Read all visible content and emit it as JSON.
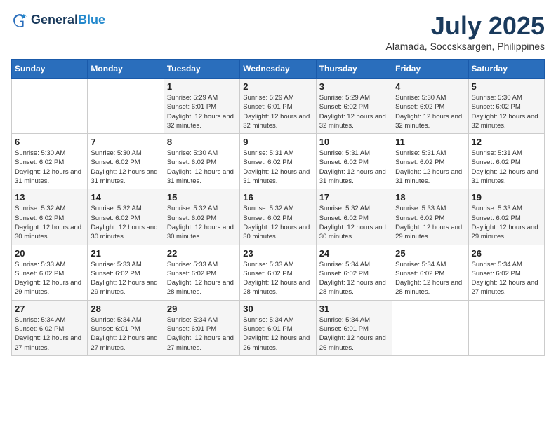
{
  "header": {
    "logo_general": "General",
    "logo_blue": "Blue",
    "month_year": "July 2025",
    "location": "Alamada, Soccsksargen, Philippines"
  },
  "weekdays": [
    "Sunday",
    "Monday",
    "Tuesday",
    "Wednesday",
    "Thursday",
    "Friday",
    "Saturday"
  ],
  "weeks": [
    [
      {
        "day": "",
        "info": ""
      },
      {
        "day": "",
        "info": ""
      },
      {
        "day": "1",
        "info": "Sunrise: 5:29 AM\nSunset: 6:01 PM\nDaylight: 12 hours and 32 minutes."
      },
      {
        "day": "2",
        "info": "Sunrise: 5:29 AM\nSunset: 6:01 PM\nDaylight: 12 hours and 32 minutes."
      },
      {
        "day": "3",
        "info": "Sunrise: 5:29 AM\nSunset: 6:02 PM\nDaylight: 12 hours and 32 minutes."
      },
      {
        "day": "4",
        "info": "Sunrise: 5:30 AM\nSunset: 6:02 PM\nDaylight: 12 hours and 32 minutes."
      },
      {
        "day": "5",
        "info": "Sunrise: 5:30 AM\nSunset: 6:02 PM\nDaylight: 12 hours and 32 minutes."
      }
    ],
    [
      {
        "day": "6",
        "info": "Sunrise: 5:30 AM\nSunset: 6:02 PM\nDaylight: 12 hours and 31 minutes."
      },
      {
        "day": "7",
        "info": "Sunrise: 5:30 AM\nSunset: 6:02 PM\nDaylight: 12 hours and 31 minutes."
      },
      {
        "day": "8",
        "info": "Sunrise: 5:30 AM\nSunset: 6:02 PM\nDaylight: 12 hours and 31 minutes."
      },
      {
        "day": "9",
        "info": "Sunrise: 5:31 AM\nSunset: 6:02 PM\nDaylight: 12 hours and 31 minutes."
      },
      {
        "day": "10",
        "info": "Sunrise: 5:31 AM\nSunset: 6:02 PM\nDaylight: 12 hours and 31 minutes."
      },
      {
        "day": "11",
        "info": "Sunrise: 5:31 AM\nSunset: 6:02 PM\nDaylight: 12 hours and 31 minutes."
      },
      {
        "day": "12",
        "info": "Sunrise: 5:31 AM\nSunset: 6:02 PM\nDaylight: 12 hours and 31 minutes."
      }
    ],
    [
      {
        "day": "13",
        "info": "Sunrise: 5:32 AM\nSunset: 6:02 PM\nDaylight: 12 hours and 30 minutes."
      },
      {
        "day": "14",
        "info": "Sunrise: 5:32 AM\nSunset: 6:02 PM\nDaylight: 12 hours and 30 minutes."
      },
      {
        "day": "15",
        "info": "Sunrise: 5:32 AM\nSunset: 6:02 PM\nDaylight: 12 hours and 30 minutes."
      },
      {
        "day": "16",
        "info": "Sunrise: 5:32 AM\nSunset: 6:02 PM\nDaylight: 12 hours and 30 minutes."
      },
      {
        "day": "17",
        "info": "Sunrise: 5:32 AM\nSunset: 6:02 PM\nDaylight: 12 hours and 30 minutes."
      },
      {
        "day": "18",
        "info": "Sunrise: 5:33 AM\nSunset: 6:02 PM\nDaylight: 12 hours and 29 minutes."
      },
      {
        "day": "19",
        "info": "Sunrise: 5:33 AM\nSunset: 6:02 PM\nDaylight: 12 hours and 29 minutes."
      }
    ],
    [
      {
        "day": "20",
        "info": "Sunrise: 5:33 AM\nSunset: 6:02 PM\nDaylight: 12 hours and 29 minutes."
      },
      {
        "day": "21",
        "info": "Sunrise: 5:33 AM\nSunset: 6:02 PM\nDaylight: 12 hours and 29 minutes."
      },
      {
        "day": "22",
        "info": "Sunrise: 5:33 AM\nSunset: 6:02 PM\nDaylight: 12 hours and 28 minutes."
      },
      {
        "day": "23",
        "info": "Sunrise: 5:33 AM\nSunset: 6:02 PM\nDaylight: 12 hours and 28 minutes."
      },
      {
        "day": "24",
        "info": "Sunrise: 5:34 AM\nSunset: 6:02 PM\nDaylight: 12 hours and 28 minutes."
      },
      {
        "day": "25",
        "info": "Sunrise: 5:34 AM\nSunset: 6:02 PM\nDaylight: 12 hours and 28 minutes."
      },
      {
        "day": "26",
        "info": "Sunrise: 5:34 AM\nSunset: 6:02 PM\nDaylight: 12 hours and 27 minutes."
      }
    ],
    [
      {
        "day": "27",
        "info": "Sunrise: 5:34 AM\nSunset: 6:02 PM\nDaylight: 12 hours and 27 minutes."
      },
      {
        "day": "28",
        "info": "Sunrise: 5:34 AM\nSunset: 6:01 PM\nDaylight: 12 hours and 27 minutes."
      },
      {
        "day": "29",
        "info": "Sunrise: 5:34 AM\nSunset: 6:01 PM\nDaylight: 12 hours and 27 minutes."
      },
      {
        "day": "30",
        "info": "Sunrise: 5:34 AM\nSunset: 6:01 PM\nDaylight: 12 hours and 26 minutes."
      },
      {
        "day": "31",
        "info": "Sunrise: 5:34 AM\nSunset: 6:01 PM\nDaylight: 12 hours and 26 minutes."
      },
      {
        "day": "",
        "info": ""
      },
      {
        "day": "",
        "info": ""
      }
    ]
  ]
}
